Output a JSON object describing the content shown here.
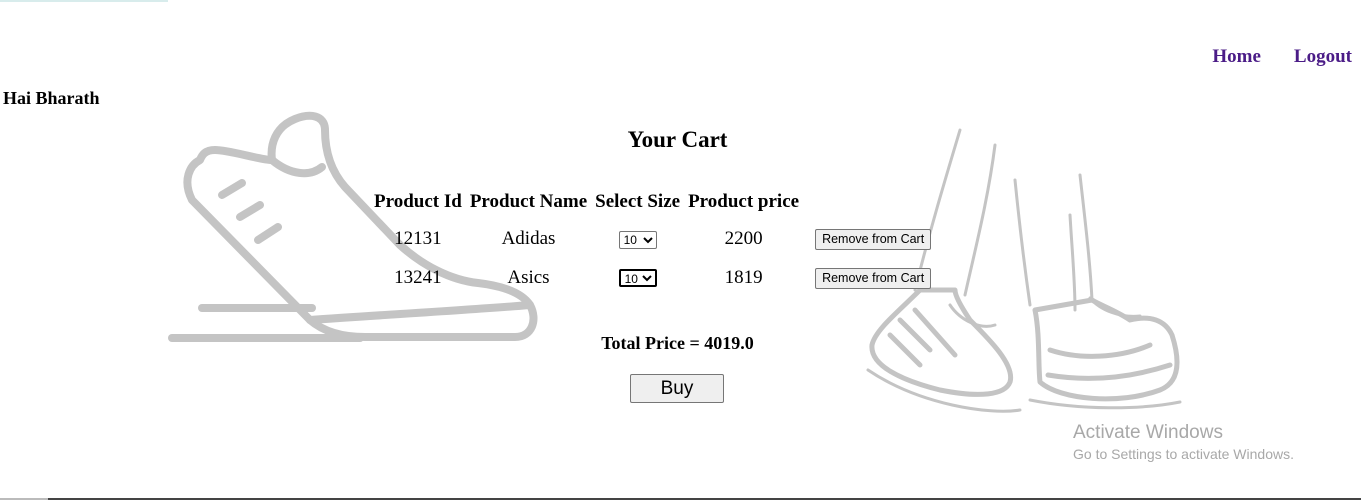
{
  "nav": {
    "home_label": "Home",
    "logout_label": "Logout"
  },
  "greeting": "Hai Bharath",
  "cart": {
    "title": "Your Cart",
    "headers": [
      "Product Id",
      "Product Name",
      "Select Size",
      "Product price"
    ],
    "rows": [
      {
        "id": "12131",
        "name": "Adidas",
        "size": "10",
        "price": "2200",
        "action": "Remove from Cart"
      },
      {
        "id": "13241",
        "name": "Asics",
        "size": "10",
        "price": "1819",
        "action": "Remove from Cart"
      }
    ],
    "total_text": "Total Price = 4019.0",
    "buy_label": "Buy"
  },
  "watermark": {
    "title": "Activate Windows",
    "subtitle": "Go to Settings to activate Windows."
  },
  "colors": {
    "nav_link": "#4b1c87",
    "artwork": "#c4c4c4"
  }
}
